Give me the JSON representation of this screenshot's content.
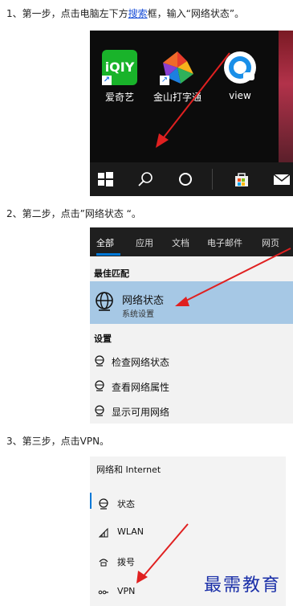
{
  "steps": {
    "step1_prefix": "1、第一步，点击电脑左下方",
    "step1_link": "搜索",
    "step1_suffix": "框，输入“网络状态”。",
    "step2": "2、第二步，点击”网络状态 “。",
    "step3": "3、第三步，点击VPN。"
  },
  "desktop": {
    "apps": [
      {
        "name": "爱奇艺",
        "icon": "iqiyi-icon",
        "icon_text": "iQIY"
      },
      {
        "name": "金山打字通",
        "icon": "wps-typing-icon"
      },
      {
        "name": "view",
        "icon": "view-icon"
      }
    ],
    "taskbar_icons": [
      "windows-start-icon",
      "search-icon",
      "cortana-icon",
      "store-icon",
      "mail-icon"
    ]
  },
  "search_panel": {
    "tabs": [
      "全部",
      "应用",
      "文档",
      "电子邮件",
      "网页"
    ],
    "best_match_heading": "最佳匹配",
    "best_match": {
      "title": "网络状态",
      "subtitle": "系统设置"
    },
    "settings_heading": "设置",
    "settings_items": [
      "检查网络状态",
      "查看网络属性",
      "显示可用网络"
    ]
  },
  "settings_panel": {
    "header": "网络和 Internet",
    "items": [
      "状态",
      "WLAN",
      "拨号",
      "VPN"
    ]
  },
  "watermark": "最需教育",
  "colors": {
    "link": "#1a4fd8",
    "highlight": "#a6c8e5",
    "accent": "#0078d7",
    "arrow": "#e02020"
  }
}
